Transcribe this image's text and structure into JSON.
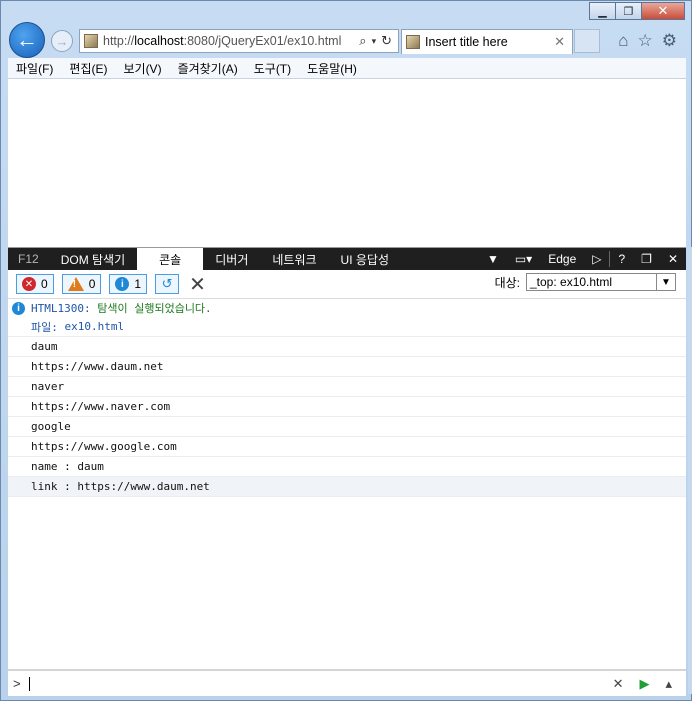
{
  "window": {
    "minimize": "▁",
    "maximize": "❐",
    "close": "✕"
  },
  "nav": {
    "back_icon": "back-arrow-icon",
    "forward_icon": "forward-arrow-icon"
  },
  "address": {
    "prefix": "http://",
    "host": "localhost",
    "path": ":8080/jQueryEx01/ex10.html"
  },
  "tab": {
    "title": "Insert title here",
    "close": "✕"
  },
  "menu": [
    "파일(F)",
    "편집(E)",
    "보기(V)",
    "즐겨찾기(A)",
    "도구(T)",
    "도움말(H)"
  ],
  "devtools": {
    "f12": "F12",
    "tabs": [
      "DOM 탐색기",
      "콘솔",
      "디버거",
      "네트워크",
      "UI 응답성"
    ],
    "active_tab": "콘솔",
    "mode": "Edge",
    "help": "?",
    "close": "✕"
  },
  "console_toolbar": {
    "errors": "0",
    "warnings": "0",
    "info": "1",
    "target_label": "대상:",
    "target_value": "_top: ex10.html"
  },
  "console": {
    "message_code": "HTML1300:",
    "message_text": "탐색이 실행되었습니다.",
    "file_label": "파일:",
    "file_name": "ex10.html",
    "lines": [
      "daum",
      "https://www.daum.net",
      "naver",
      "https://www.naver.com",
      "google",
      "https://www.google.com",
      "name : daum",
      "link : https://www.daum.net"
    ]
  },
  "cmd": {
    "prompt": ">"
  },
  "colors": {
    "accent": "#1e88d6",
    "devtools_bar": "#1f1f1f",
    "error": "#d0262c",
    "warning": "#e07b17",
    "success_text": "#1d7a1d"
  }
}
